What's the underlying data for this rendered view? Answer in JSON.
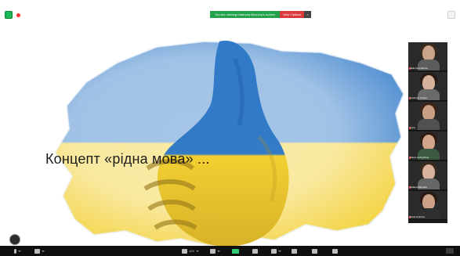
{
  "colors": {
    "ukraine_blue": "#2f79c7",
    "ukraine_yellow": "#f2cf2f",
    "share_green": "#22a24a",
    "stop_red": "#d93a3a",
    "panel_bg": "#1b1b1b",
    "toolbar_bg": "#0f0f0f"
  },
  "share_banner": {
    "message": "You are viewing Kateryna Borzova's screen",
    "stop_label": "View Options",
    "close_label": "×"
  },
  "slide": {
    "title": "Концепт «рідна мова» ..."
  },
  "participants": [
    {
      "name": "Iuliia Korzhakova"
    },
    {
      "name": "Liudmyla Turkas"
    },
    {
      "name": "Iryna"
    },
    {
      "name": "Olena Lozhyshina"
    },
    {
      "name": "Tetiana Barnisko"
    },
    {
      "name": "Daria Smirnov"
    }
  ],
  "toolbar": {
    "participants_count": "103",
    "icons": [
      "mic-icon",
      "video-icon",
      "participants-icon",
      "chat-icon",
      "share-icon",
      "record-icon",
      "reactions-icon",
      "apps-icon",
      "whiteboard-icon",
      "more-icon"
    ]
  }
}
